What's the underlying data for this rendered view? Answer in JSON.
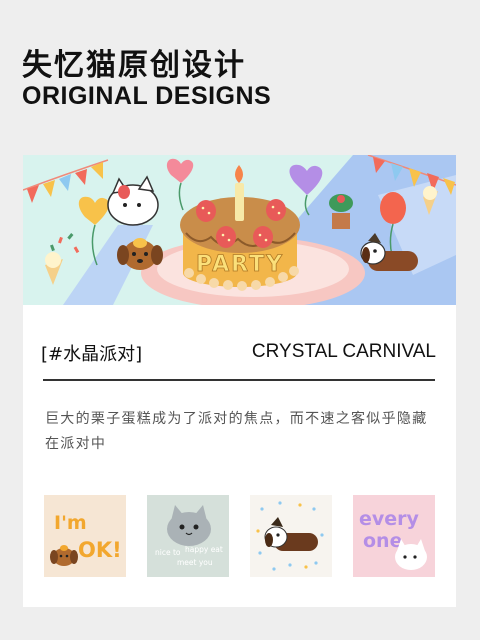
{
  "header": {
    "title_cn": "失忆猫原创设计",
    "title_en": "ORIGINAL DESIGNS"
  },
  "hero": {
    "cake_text": "PARTY",
    "palette": {
      "sky": "#d8f3ee",
      "floor_blue": "#aac7f2",
      "cake_orange": "#f2b64a",
      "plate_pink": "#f7c7c2",
      "strawberry": "#e85a58",
      "balloon_yellow": "#f8c24a",
      "balloon_pink": "#f48a9a",
      "balloon_purple": "#b48ee6",
      "balloon_red": "#f3654e"
    }
  },
  "section": {
    "tag": "[#水晶派对]",
    "tag_en": "CRYSTAL CARNIVAL",
    "description": "巨大的栗子蛋糕成为了派对的焦点，而不速之客似乎隐藏在派对中"
  },
  "stickers": [
    {
      "name": "im-ok",
      "text_line1": "I'm",
      "text_line2": "OK!",
      "bg": "#f6e6d4"
    },
    {
      "name": "nice-to-meet-you",
      "text_line1": "nice to",
      "text_line2": "happy eat",
      "text_line3": "meet you",
      "bg": "#d5e0da"
    },
    {
      "name": "dachshund",
      "bg": "#f7f4ef"
    },
    {
      "name": "everyone",
      "text_line1": "every",
      "text_line2": "one",
      "bg": "#f7d3da"
    }
  ]
}
